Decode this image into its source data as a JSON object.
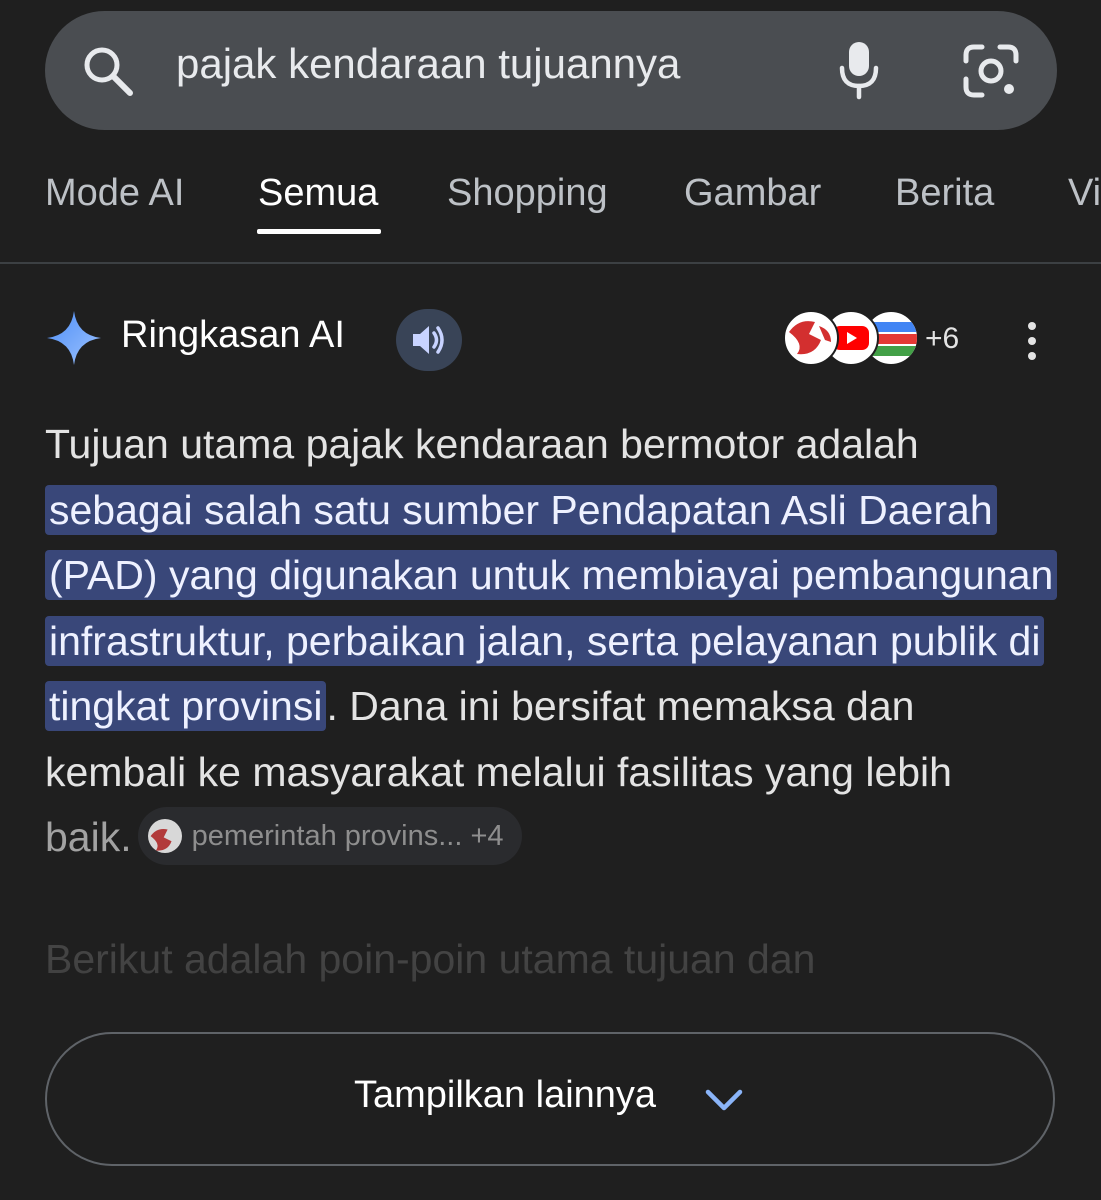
{
  "search": {
    "query": "pajak kendaraan tujuannya"
  },
  "tabs": [
    {
      "label": "Mode AI",
      "active": false
    },
    {
      "label": "Semua",
      "active": true
    },
    {
      "label": "Shopping",
      "active": false
    },
    {
      "label": "Gambar",
      "active": false
    },
    {
      "label": "Berita",
      "active": false
    },
    {
      "label": "Vi",
      "active": false
    }
  ],
  "ai_overview": {
    "title": "Ringkasan AI",
    "sources_more_count": "+6",
    "text_intro": "Tujuan utama pajak kendaraan bermotor adalah ",
    "text_highlight": "sebagai salah satu sumber Pendapatan Asli Daerah (PAD) yang digunakan untuk membiayai pembangunan infrastruktur, perbaikan jalan, serta pelayanan publik di tingkat provinsi",
    "text_after": ". Dana ini bersifat memaksa dan kembali ke masyarakat melalui fasilitas yang lebih",
    "text_tail": "baik.",
    "source_chip_label": "pemerintah provins...",
    "source_chip_count": "+4",
    "next_paragraph": "Berikut adalah poin-poin utama tujuan dan"
  },
  "show_more": {
    "label": "Tampilkan lainnya"
  },
  "colors": {
    "background": "#1f1f1f",
    "search_bar": "#4a4d51",
    "highlight": "#394779",
    "accent_blue": "#8ab4f8"
  }
}
